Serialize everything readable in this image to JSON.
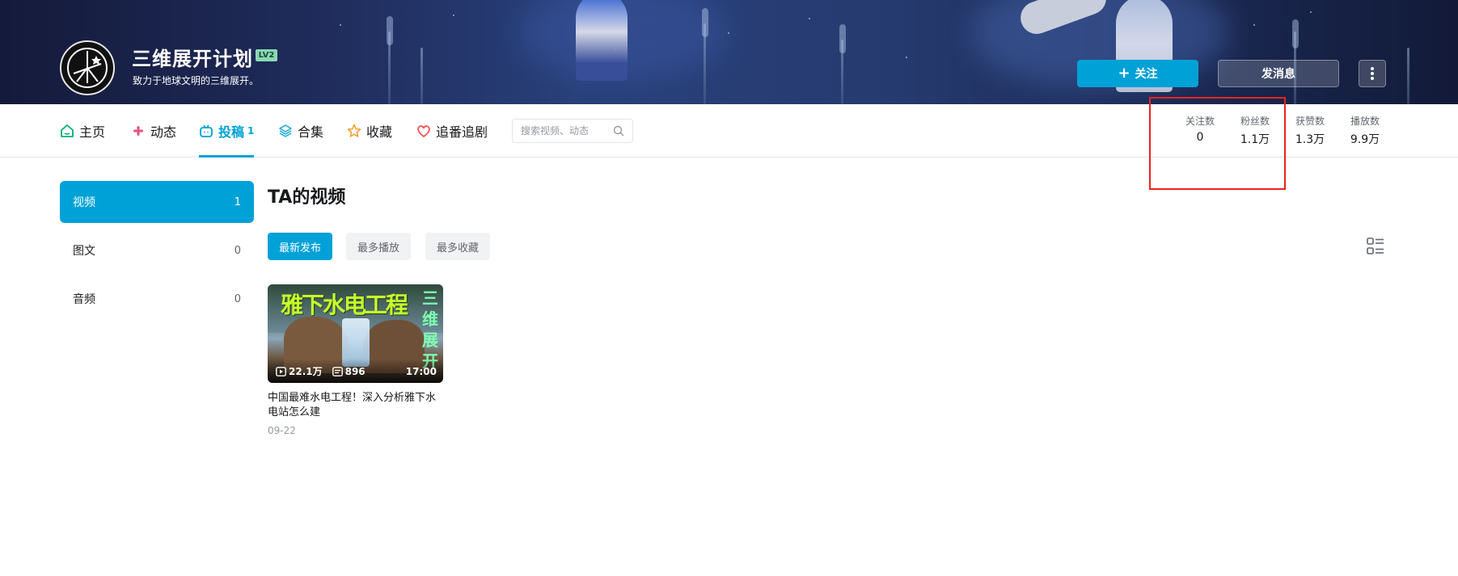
{
  "header": {
    "user_name": "三维展开计划",
    "level": "LV2",
    "sign": "致力于地球文明的三维展开。",
    "follow_label": "关注",
    "message_label": "发消息"
  },
  "nav": {
    "items": [
      {
        "label": "主页"
      },
      {
        "label": "动态"
      },
      {
        "label": "投稿",
        "count": "1"
      },
      {
        "label": "合集"
      },
      {
        "label": "收藏"
      },
      {
        "label": "追番追剧"
      }
    ],
    "search_placeholder": "搜索视频、动态"
  },
  "stats": [
    {
      "label": "关注数",
      "value": "0"
    },
    {
      "label": "粉丝数",
      "value": "1.1万"
    },
    {
      "label": "获赞数",
      "value": "1.3万"
    },
    {
      "label": "播放数",
      "value": "9.9万"
    }
  ],
  "sidebar": {
    "items": [
      {
        "label": "视频",
        "count": "1"
      },
      {
        "label": "图文",
        "count": "0"
      },
      {
        "label": "音频",
        "count": "0"
      }
    ]
  },
  "main": {
    "title": "TA的视频",
    "sort_tabs": [
      "最新发布",
      "最多播放",
      "最多收藏"
    ]
  },
  "video": {
    "thumb_title": "雅下水电工程",
    "thumb_side": "三维展开",
    "plays": "22.1万",
    "danmaku": "896",
    "duration": "17:00",
    "title": "中国最难水电工程！深入分析雅下水电站怎么建",
    "date": "09-22"
  },
  "colors": {
    "accent": "#00a1d6",
    "highlight": "#e8241a",
    "level_badge": "#8ad8b4"
  }
}
